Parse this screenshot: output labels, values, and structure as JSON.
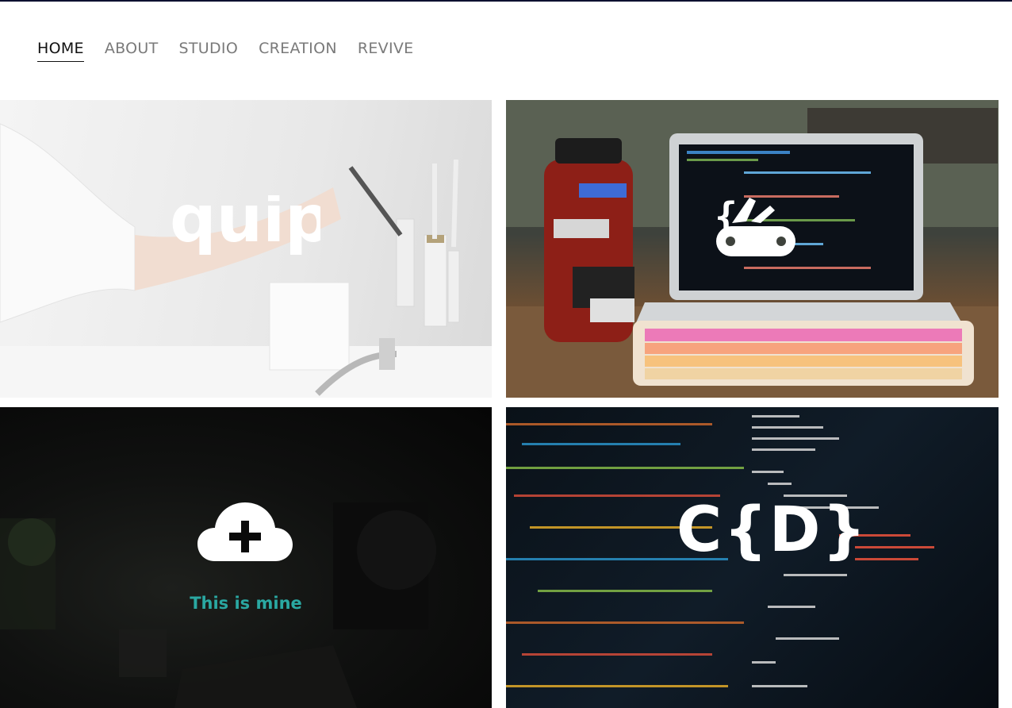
{
  "nav": {
    "items": [
      {
        "label": "HOME",
        "active": true
      },
      {
        "label": "ABOUT",
        "active": false
      },
      {
        "label": "STUDIO",
        "active": false
      },
      {
        "label": "CREATION",
        "active": false
      },
      {
        "label": "REVIVE",
        "active": false
      }
    ]
  },
  "tiles": {
    "quip": {
      "logo_text": "quip"
    },
    "devtools": {
      "icon": "code-swiss-knife-icon"
    },
    "mine": {
      "icon": "cloud-plus-icon",
      "caption": "This is mine"
    },
    "cd": {
      "logo_text": "C{D}"
    }
  },
  "colors": {
    "caption": "#2aa8a2",
    "nav_active": "#111111",
    "nav_inactive": "#7a7a7a",
    "top_rule": "#0d1030"
  }
}
